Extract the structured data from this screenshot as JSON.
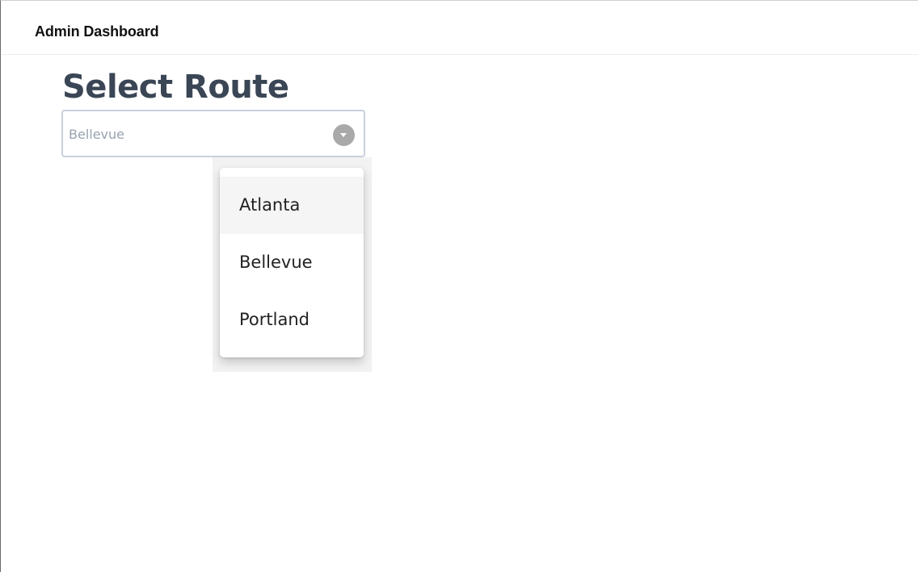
{
  "header": {
    "title": "Admin Dashboard"
  },
  "page": {
    "title": "Select Route"
  },
  "route_select": {
    "selected_value": "Bellevue",
    "toggle_icon": "chevron-down-icon",
    "options": [
      {
        "label": "Atlanta",
        "highlighted": true
      },
      {
        "label": "Bellevue",
        "highlighted": false
      },
      {
        "label": "Portland",
        "highlighted": false
      }
    ]
  },
  "colors": {
    "title_text": "#3a4655",
    "select_border": "#c8d1dc",
    "select_value_text": "#98a3b0",
    "toggle_background": "#a9a9a9",
    "option_highlight": "#f5f5f5"
  }
}
